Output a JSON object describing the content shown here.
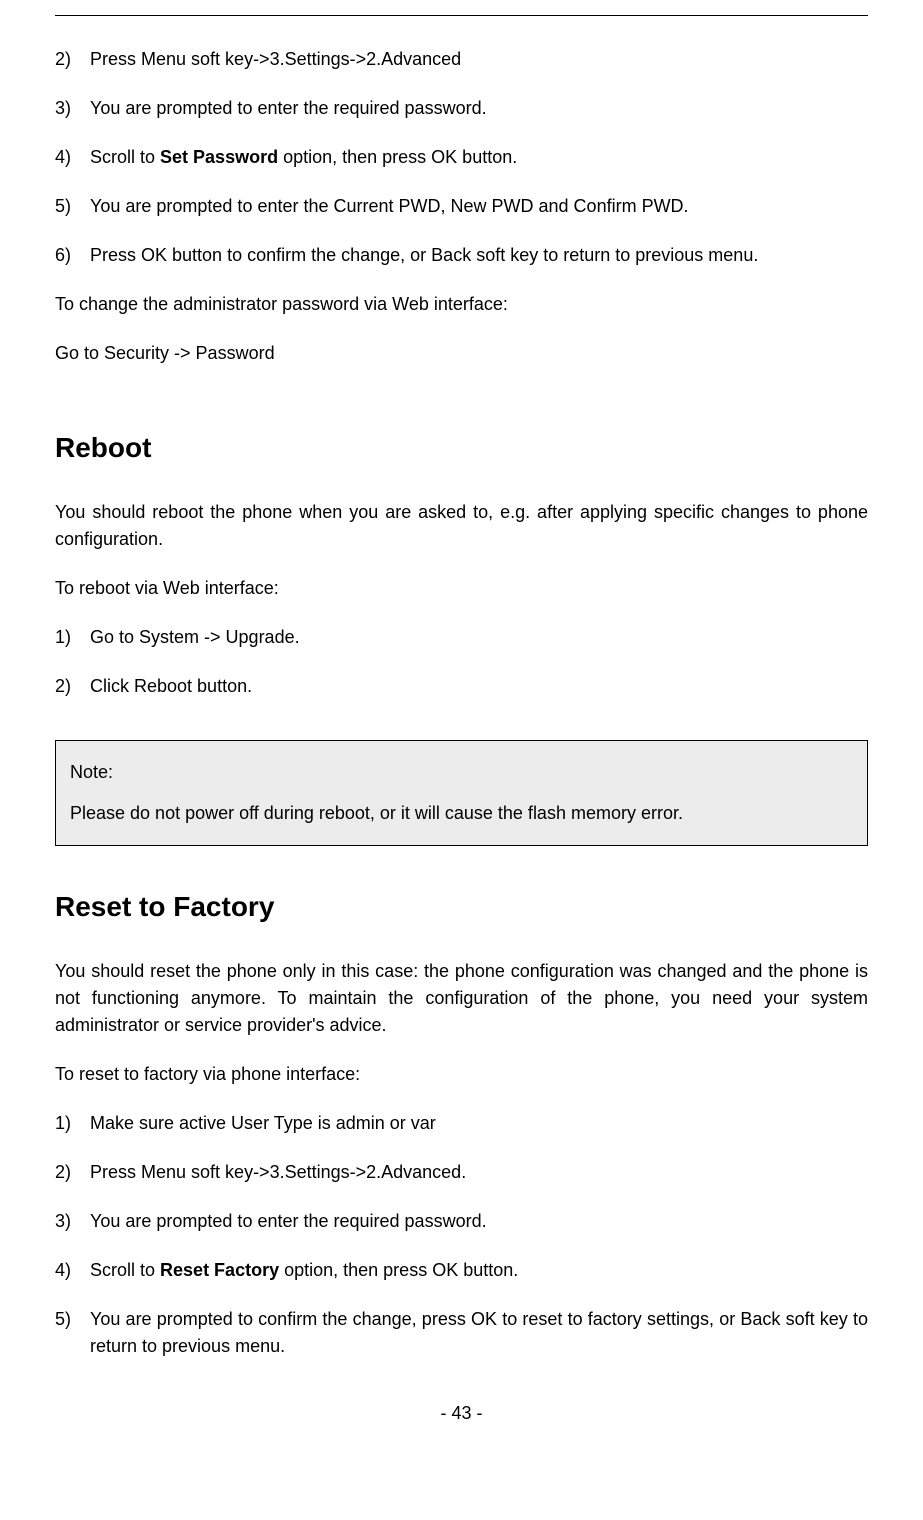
{
  "list1": {
    "item2": {
      "num": "2)",
      "text_a": "Press Menu soft key->3.Settings->2.Advanced"
    },
    "item3": {
      "num": "3)",
      "text_a": "You are prompted to enter the required password."
    },
    "item4": {
      "num": "4)",
      "text_a": "Scroll to ",
      "bold": "Set Password",
      "text_b": " option, then press OK button."
    },
    "item5": {
      "num": "5)",
      "text_a": "You are prompted to enter the Current PWD, New PWD and Confirm PWD."
    },
    "item6": {
      "num": "6)",
      "text_a": "Press OK button to confirm the change, or Back soft key to return to previous menu."
    }
  },
  "para1": "To change the administrator password via Web interface:",
  "para2": "Go to Security -> Password",
  "heading1": "Reboot",
  "para3": "You should reboot the phone when you are asked to, e.g. after applying specific changes to phone configuration.",
  "para4": "To reboot via Web interface:",
  "list2": {
    "item1": {
      "num": "1)",
      "text_a": "Go to System -> Upgrade."
    },
    "item2": {
      "num": "2)",
      "text_a": "Click Reboot button."
    }
  },
  "note": {
    "title": "Note:",
    "body": "Please do not power off during reboot, or it will cause the flash memory error."
  },
  "heading2": "Reset to Factory",
  "para5": "You should reset the phone only in this case: the phone configuration was changed and the phone is not functioning anymore. To maintain the configuration of the phone, you need your system administrator or service provider's advice.",
  "para6": "To reset to factory via phone interface:",
  "list3": {
    "item1": {
      "num": "1)",
      "text_a": "Make sure active User Type is admin or var"
    },
    "item2": {
      "num": "2)",
      "text_a": "Press Menu soft key->3.Settings->2.Advanced."
    },
    "item3": {
      "num": "3)",
      "text_a": "You are prompted to enter the required password."
    },
    "item4": {
      "num": "4)",
      "text_a": "Scroll to ",
      "bold": "Reset Factory",
      "text_b": " option, then press OK button."
    },
    "item5": {
      "num": "5)",
      "text_a": "You are prompted to confirm the change, press OK to reset to factory settings, or Back soft key to return to previous menu."
    }
  },
  "page_num": "- 43 -"
}
